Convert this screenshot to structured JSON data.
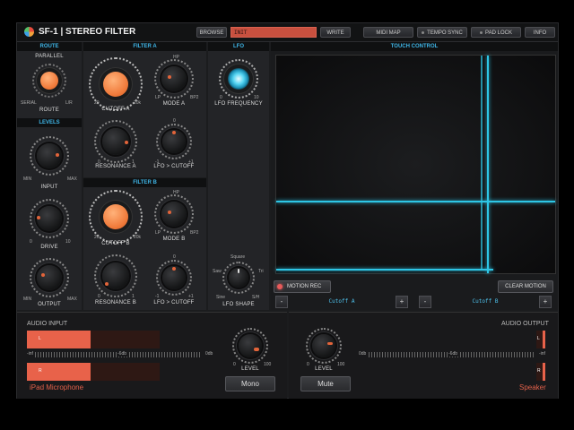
{
  "app": {
    "title": "SF-1 | STEREO FILTER"
  },
  "toolbar": {
    "browse": "BROWSE",
    "preset": "INIT",
    "write": "WRITE",
    "midi_map": "MIDI MAP",
    "tempo_sync": "TEMPO SYNC",
    "pad_lock": "PAD LOCK",
    "info": "INFO"
  },
  "route": {
    "header": "ROUTE",
    "parallel": "PARALLEL",
    "serial": "SERIAL",
    "lr": "L/R",
    "label": "ROUTE"
  },
  "levels": {
    "header": "LEVELS",
    "input": {
      "label": "INPUT",
      "min": "MIN",
      "max": "MAX"
    },
    "drive": {
      "label": "DRIVE",
      "min": "0",
      "max": "10"
    },
    "output": {
      "label": "OUTPUT",
      "min": "MIN",
      "max": "MAX"
    }
  },
  "filter_a": {
    "header": "FILTER A",
    "cutoff": {
      "label": "CUTOFF A",
      "min": "20",
      "max": "20k"
    },
    "mode": {
      "label": "MODE A",
      "lp": "LP",
      "hp": "HP",
      "bp": "BP",
      "bp2": "BP2"
    },
    "resonance": {
      "label": "RESONANCE A",
      "min": "0",
      "max": "1"
    },
    "lfo_cutoff": {
      "label": "LFO > CUTOFF",
      "min": "-1",
      "mid": "0",
      "max": "+1"
    }
  },
  "filter_b": {
    "header": "FILTER B",
    "cutoff": {
      "label": "CUTOFF B",
      "min": "20",
      "max": "20k"
    },
    "mode": {
      "label": "MODE B",
      "lp": "LP",
      "hp": "HP",
      "bp": "BP",
      "bp2": "BP2"
    },
    "resonance": {
      "label": "RESONANCE B",
      "min": "0",
      "max": "1"
    },
    "lfo_cutoff": {
      "label": "LFO > CUTOFF",
      "min": "-1",
      "mid": "0",
      "max": "+1"
    }
  },
  "lfo": {
    "header": "LFO",
    "frequency": {
      "label": "LFO FREQUENCY",
      "min": "0",
      "max": "10"
    },
    "shape": {
      "label": "LFO SHAPE",
      "square": "Square",
      "saw": "Saw",
      "tri": "Tri",
      "sine": "Sine",
      "sh": "S/H"
    }
  },
  "touch": {
    "header": "TOUCH CONTROL",
    "motion_rec": "MOTION REC",
    "clear_motion": "CLEAR MOTION",
    "x_param": "Cutoff A",
    "y_param": "Cutoff B",
    "minus": "-",
    "plus": "+",
    "accent": "#2ec6e6"
  },
  "audio_input": {
    "title": "AUDIO INPUT",
    "ch_l": "L",
    "ch_r": "R",
    "neg_inf": "-inf",
    "mid": "-6db",
    "zero": "0db",
    "level_label": "LEVEL",
    "level_min": "0",
    "level_max": "100",
    "device": "iPad Microphone",
    "mono": "Mono",
    "meter_l": 0.48,
    "meter_r": 0.48
  },
  "audio_output": {
    "title": "AUDIO OUTPUT",
    "ch_l": "L",
    "ch_r": "R",
    "zero": "0db",
    "mid": "-6db",
    "neg_inf": "-inf",
    "level_label": "LEVEL",
    "level_min": "0",
    "level_max": "100",
    "device": "Speaker",
    "mute": "Mute"
  },
  "colors": {
    "accent_orange": "#f07a3a",
    "accent_blue": "#3fb6e8",
    "meter_red": "#e8624a"
  }
}
